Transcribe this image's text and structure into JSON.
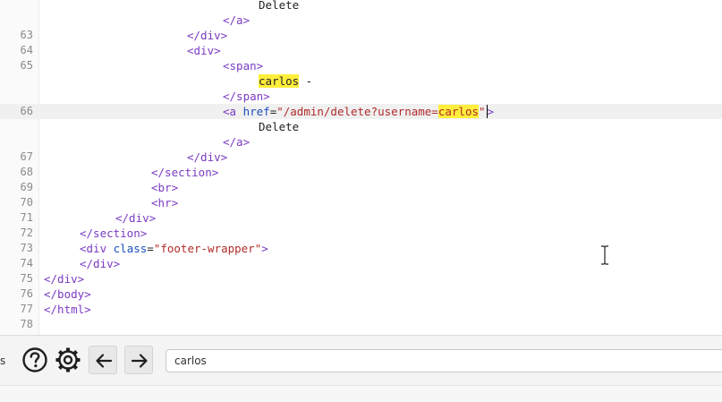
{
  "editor": {
    "lines": [
      {
        "num": "",
        "indent": 240,
        "parts": [
          {
            "t": "text",
            "v": "Delete"
          }
        ]
      },
      {
        "num": "",
        "indent": 200,
        "parts": [
          {
            "t": "tag",
            "v": "</a>"
          }
        ]
      },
      {
        "num": "63",
        "indent": 160,
        "parts": [
          {
            "t": "tag",
            "v": "</div>"
          }
        ]
      },
      {
        "num": "64",
        "indent": 160,
        "parts": [
          {
            "t": "tag",
            "v": "<div>"
          }
        ]
      },
      {
        "num": "65",
        "indent": 200,
        "parts": [
          {
            "t": "tag",
            "v": "<span>"
          }
        ]
      },
      {
        "num": "",
        "indent": 240,
        "parts": [
          {
            "t": "hltext",
            "v": "carlos"
          },
          {
            "t": "text",
            "v": " -"
          }
        ]
      },
      {
        "num": "",
        "indent": 200,
        "parts": [
          {
            "t": "tag",
            "v": "</span>"
          }
        ]
      },
      {
        "num": "66",
        "indent": 200,
        "current": true,
        "parts": [
          {
            "t": "tag",
            "v": "<a "
          },
          {
            "t": "attr",
            "v": "href"
          },
          {
            "t": "text",
            "v": "="
          },
          {
            "t": "str",
            "v": "\"/admin/delete?username="
          },
          {
            "t": "hl",
            "v": "carlos"
          },
          {
            "t": "str",
            "v": "\""
          },
          {
            "t": "caret",
            "v": ">"
          }
        ]
      },
      {
        "num": "",
        "indent": 240,
        "parts": [
          {
            "t": "text",
            "v": "Delete"
          }
        ]
      },
      {
        "num": "",
        "indent": 200,
        "parts": [
          {
            "t": "tag",
            "v": "</a>"
          }
        ]
      },
      {
        "num": "67",
        "indent": 160,
        "parts": [
          {
            "t": "tag",
            "v": "</div>"
          }
        ]
      },
      {
        "num": "68",
        "indent": 120,
        "parts": [
          {
            "t": "tag",
            "v": "</section>"
          }
        ]
      },
      {
        "num": "69",
        "indent": 120,
        "parts": [
          {
            "t": "tag",
            "v": "<br>"
          }
        ]
      },
      {
        "num": "70",
        "indent": 120,
        "parts": [
          {
            "t": "tag",
            "v": "<hr>"
          }
        ]
      },
      {
        "num": "71",
        "indent": 80,
        "parts": [
          {
            "t": "tag",
            "v": "</div>"
          }
        ]
      },
      {
        "num": "72",
        "indent": 40,
        "parts": [
          {
            "t": "tag",
            "v": "</section>"
          }
        ]
      },
      {
        "num": "73",
        "indent": 40,
        "parts": [
          {
            "t": "tag",
            "v": "<div "
          },
          {
            "t": "attr",
            "v": "class"
          },
          {
            "t": "text",
            "v": "="
          },
          {
            "t": "str",
            "v": "\"footer-wrapper\""
          },
          {
            "t": "tag",
            "v": ">"
          }
        ]
      },
      {
        "num": "74",
        "indent": 40,
        "parts": [
          {
            "t": "tag",
            "v": "</div>"
          }
        ]
      },
      {
        "num": "75",
        "indent": 0,
        "parts": [
          {
            "t": "tag",
            "v": "</div>"
          }
        ]
      },
      {
        "num": "76",
        "indent": 0,
        "parts": [
          {
            "t": "tag",
            "v": "</body>"
          }
        ]
      },
      {
        "num": "77",
        "indent": 0,
        "parts": [
          {
            "t": "tag",
            "v": "</html>"
          }
        ]
      },
      {
        "num": "78",
        "indent": 0,
        "parts": []
      }
    ]
  },
  "toolbar": {
    "cut_label": "s",
    "help_icon": "help-circle-icon",
    "settings_icon": "gear-icon",
    "back_icon": "arrow-left-icon",
    "forward_icon": "arrow-right-icon",
    "search_value": "carlos"
  }
}
